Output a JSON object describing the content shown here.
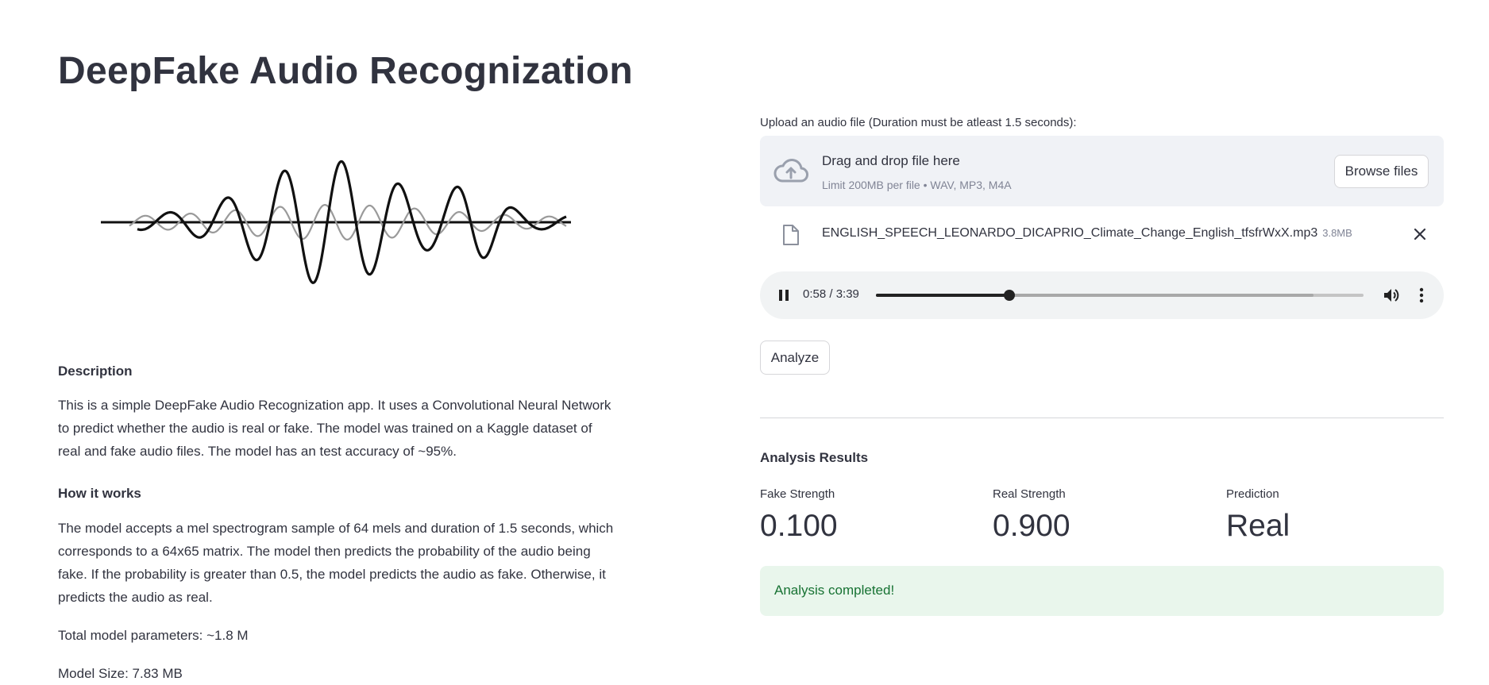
{
  "left": {
    "title": "DeepFake Audio Recognization",
    "description_heading": "Description",
    "description_text": "This is a simple DeepFake Audio Recognization app. It uses a Convolutional Neural Network to predict whether the audio is real or fake. The model was trained on a Kaggle dataset of real and fake audio files. The model has an test accuracy of ~95%.",
    "how_heading": "How it works",
    "how_text": "The model accepts a mel spectrogram sample of 64 mels and duration of 1.5 seconds, which corresponds to a 64x65 matrix. The model then predicts the probability of the audio being fake. If the probability is greater than 0.5, the model predicts the audio as fake. Otherwise, it predicts the audio as real.",
    "params_text": "Total model parameters: ~1.8 M",
    "size_text": "Model Size: 7.83 MB"
  },
  "uploader": {
    "label": "Upload an audio file (Duration must be atleast 1.5 seconds):",
    "drop_title": "Drag and drop file here",
    "drop_limit": "Limit 200MB per file • WAV, MP3, M4A",
    "browse_label": "Browse files",
    "file_name": "ENGLISH_SPEECH_LEONARDO_DICAPRIO_Climate_Change_English_tfsfrWxX.mp3",
    "file_size": "3.8MB"
  },
  "player": {
    "time": "0:58 / 3:39",
    "progress": 0.274,
    "buffered": 0.897
  },
  "analyze_label": "Analyze",
  "results": {
    "heading": "Analysis Results",
    "metrics": [
      {
        "label": "Fake Strength",
        "value": "0.100"
      },
      {
        "label": "Real Strength",
        "value": "0.900"
      },
      {
        "label": "Prediction",
        "value": "Real"
      }
    ],
    "status": "Analysis completed!"
  },
  "colors": {
    "text": "#31333f",
    "muted": "#808495",
    "dropzone_bg": "#f0f2f6",
    "success_bg": "#e9f6ec",
    "success_text": "#177233"
  },
  "icons": [
    "cloud-upload-icon",
    "file-icon",
    "close-icon",
    "pause-icon",
    "volume-icon",
    "more-vertical-icon",
    "waveform-logo"
  ]
}
